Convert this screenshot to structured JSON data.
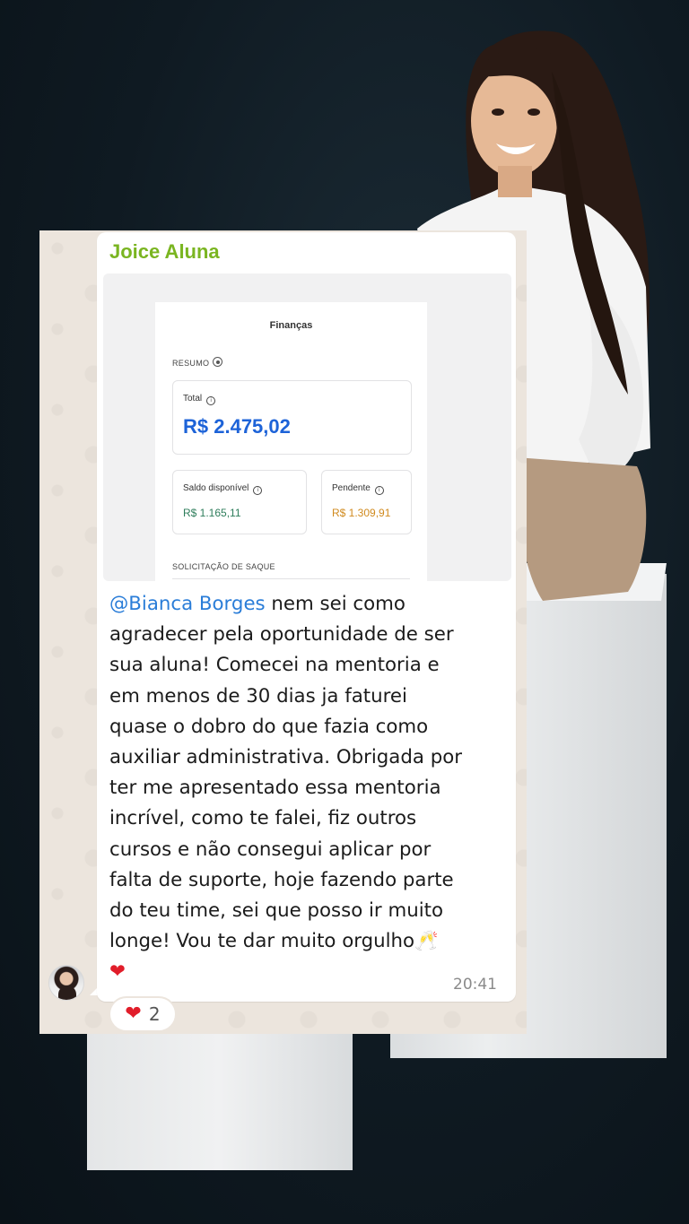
{
  "chat": {
    "sender": "Joice Aluna",
    "time": "20:41",
    "message": {
      "mention": "@Bianca Borges",
      "lines": [
        " nem sei como",
        "agradecer pela oportunidade de ser",
        "sua aluna! Comecei na mentoria e",
        "em menos de 30 dias ja faturei",
        "quase o dobro do que fazia como",
        "auxiliar administrativa. Obrigada por",
        "ter me apresentado essa mentoria",
        "incrível, como te falei, fiz outros",
        "cursos e não consegui aplicar por",
        "falta de suporte, hoje fazendo parte",
        "do teu time, sei que posso ir muito",
        "longe! Vou te dar muito orgulho"
      ],
      "emoji_glasses": "🥂",
      "emoji_heart": "❤"
    },
    "reaction": {
      "emoji": "❤",
      "count": "2"
    },
    "avatar_icon": "avatar-photo"
  },
  "finance_screenshot": {
    "title": "Finanças",
    "resumo_label": "RESUMO",
    "total_label": "Total",
    "total_value": "R$ 2.475,02",
    "saldo_label": "Saldo disponível",
    "saldo_value": "R$ 1.165,11",
    "pendente_label": "Pendente",
    "pendente_value": "R$ 1.309,91",
    "saque_label": "SOLICITAÇÃO DE SAQUE",
    "colors": {
      "total": "#1d63d8",
      "saldo": "#2e7d5b",
      "pendente": "#d08a1e"
    }
  },
  "colors": {
    "sender": "#7ab521",
    "mention": "#2a7dd8",
    "heart": "#e11d2a"
  }
}
